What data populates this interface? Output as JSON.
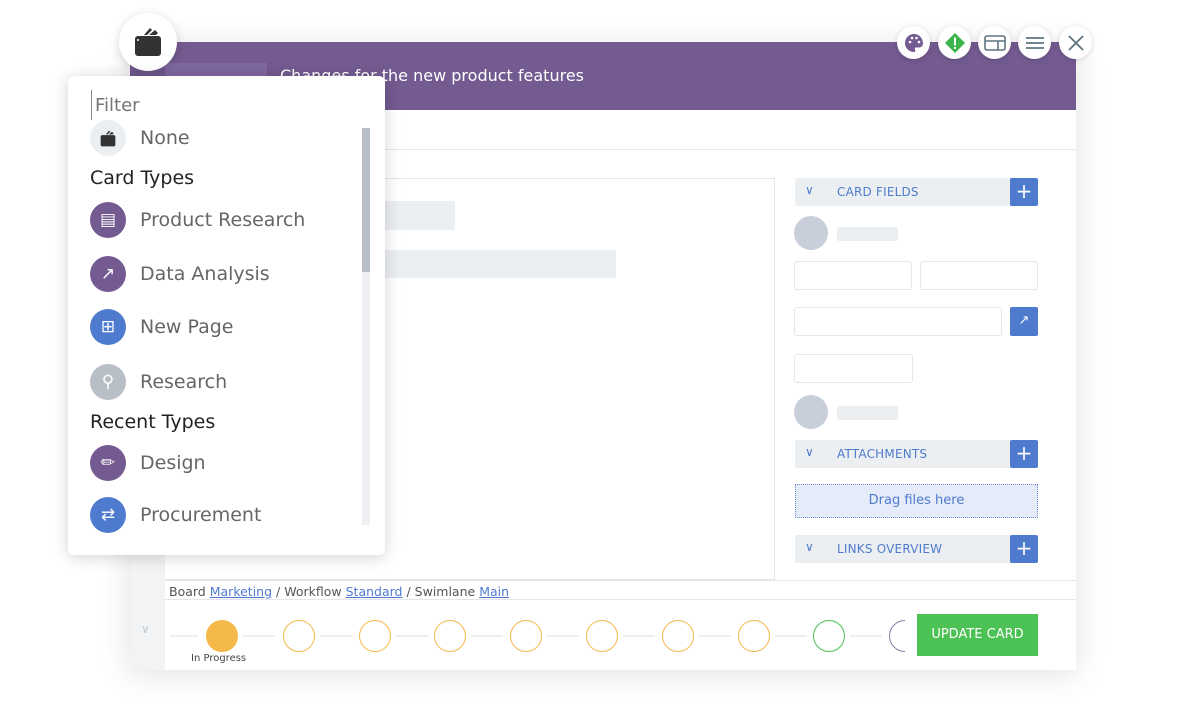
{
  "card": {
    "title": "Changes for the new product features",
    "icon": "wallet-icon"
  },
  "toolbar": [
    {
      "name": "palette-icon",
      "color": "#735a90"
    },
    {
      "name": "priority-icon",
      "color": "#3bb54a"
    },
    {
      "name": "layout-icon"
    },
    {
      "name": "menu-icon"
    },
    {
      "name": "close-icon"
    }
  ],
  "dropdown": {
    "filter_placeholder": "Filter",
    "none_label": "None",
    "card_types_heading": "Card Types",
    "card_types": [
      {
        "label": "Product Research",
        "icon": "document-search-icon",
        "color": "#735a90"
      },
      {
        "label": "Data Analysis",
        "icon": "trend-up-icon",
        "color": "#735a90"
      },
      {
        "label": "New Page",
        "icon": "add-page-icon",
        "color": "#4f7bcf"
      },
      {
        "label": "Research",
        "icon": "search-icon",
        "color": "#b8bfc7"
      }
    ],
    "recent_heading": "Recent Types",
    "recent": [
      {
        "label": "Design",
        "icon": "brush-icon",
        "color": "#735a90"
      },
      {
        "label": "Procurement",
        "icon": "swap-icon",
        "color": "#4f7bcf"
      }
    ]
  },
  "sections": {
    "card_fields": "CARD FIELDS",
    "attachments": "ATTACHMENTS",
    "drop_files": "Drag files here",
    "links": "LINKS OVERVIEW"
  },
  "breadcrumb": {
    "board_label": "Board",
    "board": "Marketing",
    "workflow_label": "Workflow",
    "workflow": "Standard",
    "swimlane_label": "Swimlane",
    "swimlane": "Main"
  },
  "workflow": {
    "current_step": "In Progress",
    "update_button": "UPDATE CARD"
  },
  "colors": {
    "header": "#735a90",
    "accent": "#4f7bcf",
    "update": "#4cc154",
    "in_progress": "#f5b94a"
  }
}
